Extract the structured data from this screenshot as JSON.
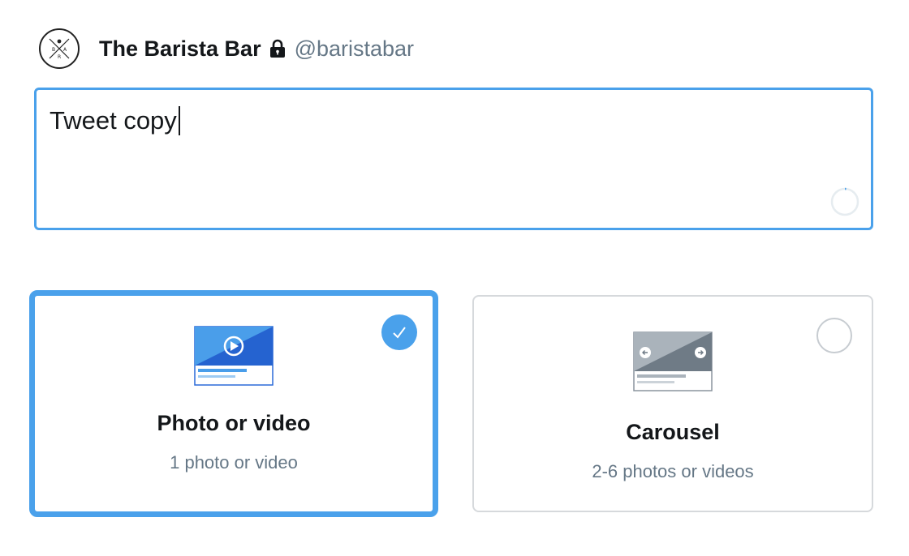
{
  "account": {
    "name": "The Barista Bar",
    "handle": "@baristabar",
    "avatar_letters": [
      "B",
      "A",
      "R"
    ]
  },
  "composer": {
    "text": "Tweet copy"
  },
  "media_options": [
    {
      "title": "Photo or video",
      "subtitle": "1 photo or video",
      "selected": true
    },
    {
      "title": "Carousel",
      "subtitle": "2-6 photos or videos",
      "selected": false
    }
  ],
  "colors": {
    "accent": "#4aa1eb",
    "text_primary": "#14171a",
    "text_secondary": "#657786",
    "border_muted": "#d6d9dc"
  },
  "icons": [
    "avatar-logo",
    "lock-icon",
    "character-counter-icon",
    "check-icon",
    "video-play-icon",
    "arrow-left-icon",
    "arrow-right-icon"
  ]
}
